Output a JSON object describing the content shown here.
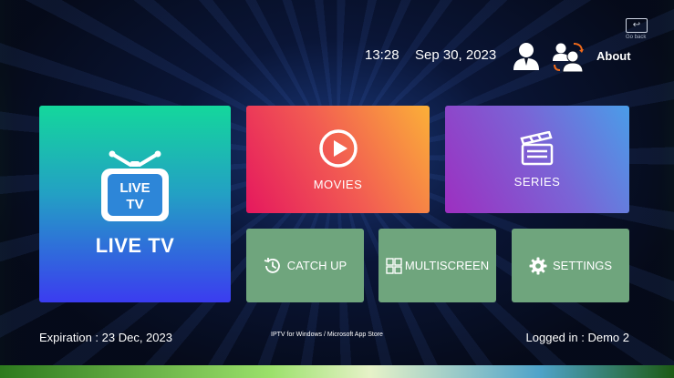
{
  "header": {
    "time": "13:28",
    "date": "Sep 30, 2023",
    "about_label": "About",
    "go_back_label": "Go back"
  },
  "tiles": {
    "live_tv": {
      "icon_text_top": "LIVE",
      "icon_text_bottom": "TV",
      "label": "LIVE TV"
    },
    "movies": {
      "label": "MOVIES"
    },
    "series": {
      "label": "SERIES"
    },
    "catch_up": {
      "label": "CATCH UP"
    },
    "multiscreen": {
      "label": "MULTISCREEN"
    },
    "settings": {
      "label": "SETTINGS"
    }
  },
  "footer": {
    "expiration": "Expiration : 23 Dec, 2023",
    "store_note": "IPTV for Windows / Microsoft App Store",
    "logged_in": "Logged in : Demo 2"
  },
  "colors": {
    "live_tv_gradient": [
      "#14d79c",
      "#3b3cf0"
    ],
    "movies_gradient": [
      "#e5185e",
      "#fbb038"
    ],
    "series_gradient": [
      "#9d2fc0",
      "#4a9de8"
    ],
    "small_tile": "#6fa57d"
  },
  "icons": [
    "user-icon",
    "switch-user-icon",
    "go-back-icon",
    "tv-icon",
    "play-icon",
    "clapperboard-icon",
    "history-icon",
    "grid-icon",
    "gear-icon"
  ]
}
